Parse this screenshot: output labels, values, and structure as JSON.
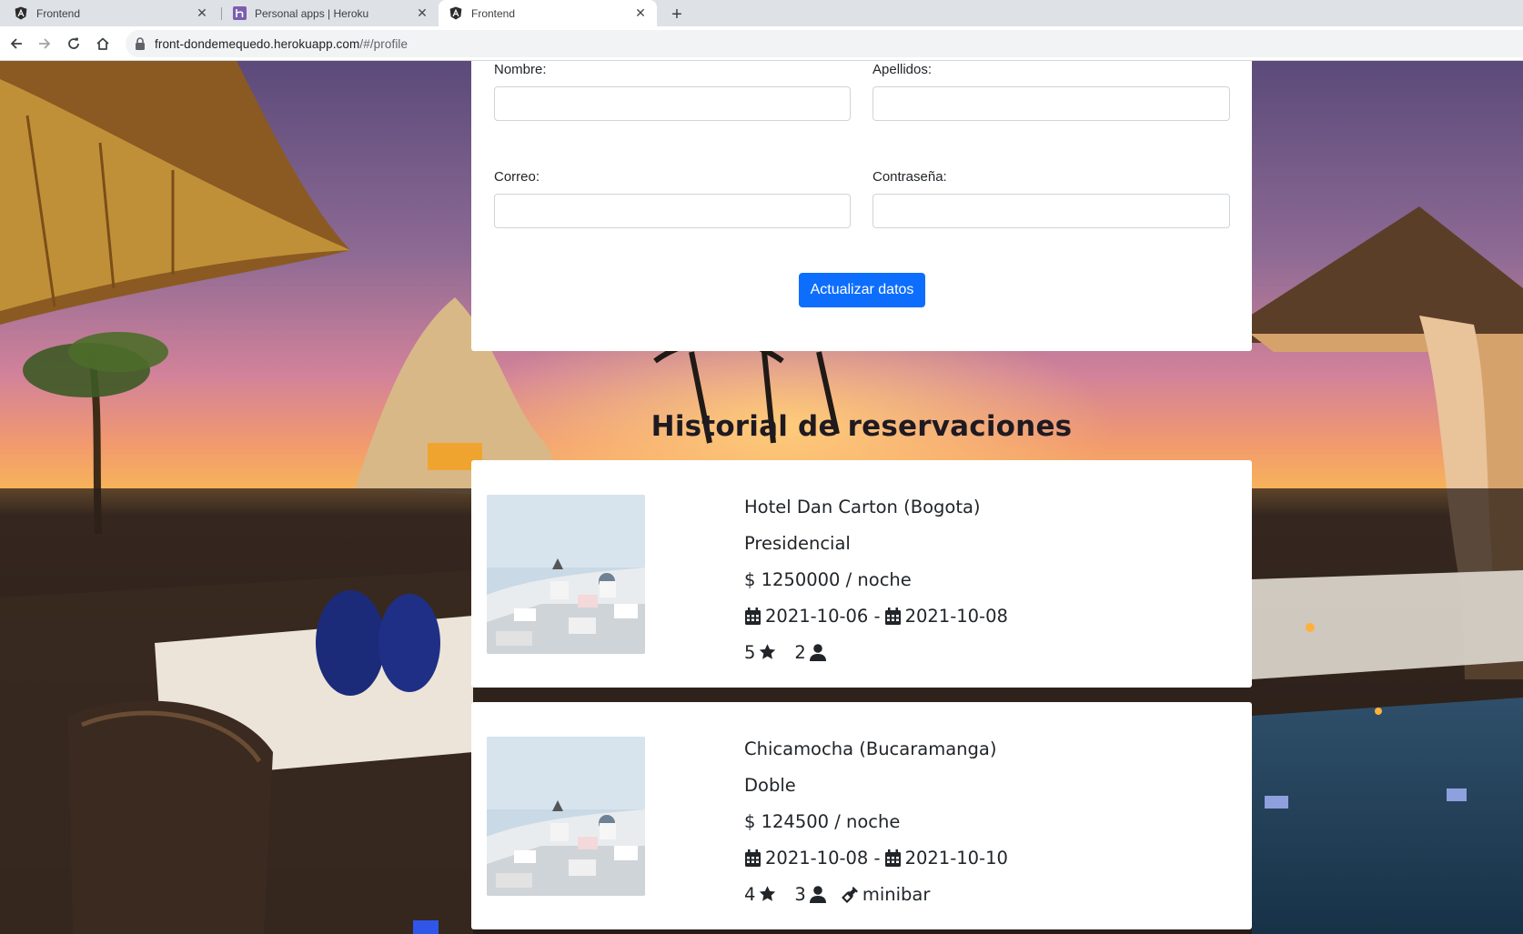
{
  "browser": {
    "tabs": [
      {
        "title": "Frontend",
        "icon": "angular-icon",
        "active": false
      },
      {
        "title": "Personal apps | Heroku",
        "icon": "heroku-icon",
        "active": false
      },
      {
        "title": "Frontend",
        "icon": "angular-icon",
        "active": true
      }
    ],
    "close_glyph": "✕",
    "new_tab_glyph": "+",
    "url_host": "front-dondemequedo.herokuapp.com",
    "url_path": "/#/profile"
  },
  "profile_form": {
    "nombre_label": "Nombre:",
    "apellidos_label": "Apellidos:",
    "correo_label": "Correo:",
    "contrasena_label": "Contraseña:",
    "nombre_value": "",
    "apellidos_value": "",
    "correo_value": "",
    "contrasena_value": "",
    "submit_label": "Actualizar datos"
  },
  "history": {
    "title": "Historial de reservaciones",
    "reservations": [
      {
        "hotel": "Hotel Dan Carton (Bogota)",
        "room_type": "Presidencial",
        "price": "$ 1250000 / noche",
        "check_in": "2021-10-06",
        "date_separator": "-",
        "check_out": "2021-10-08",
        "stars": "5",
        "guests": "2",
        "extras": ""
      },
      {
        "hotel": "Chicamocha (Bucaramanga)",
        "room_type": "Doble",
        "price": "$ 124500 / noche",
        "check_in": "2021-10-08",
        "date_separator": "-",
        "check_out": "2021-10-10",
        "stars": "4",
        "guests": "3",
        "extras": "minibar"
      }
    ]
  },
  "colors": {
    "primary": "#0d6efd",
    "tabbar": "#dee1e6",
    "text": "#212529"
  }
}
